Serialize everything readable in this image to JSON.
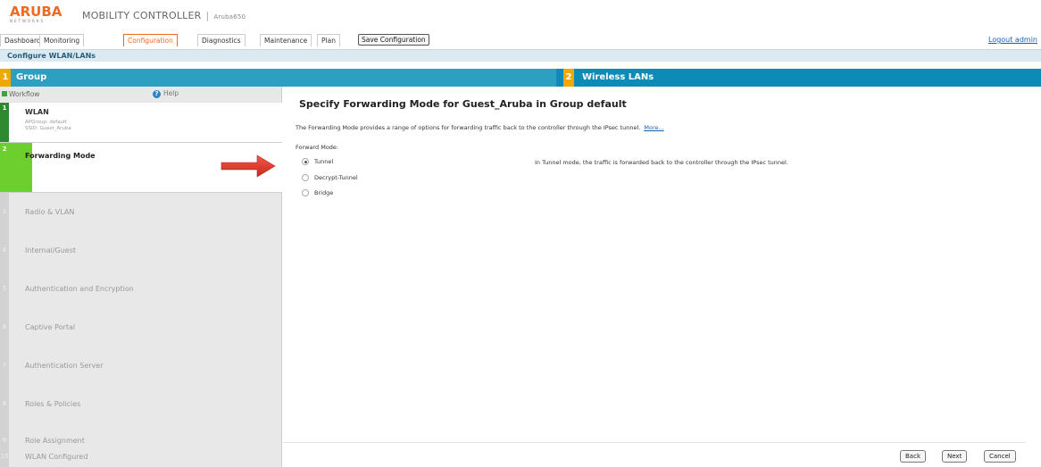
{
  "header": {
    "logo_text": "ARUBA",
    "logo_sub": "NETWORKS",
    "product": "MOBILITY CONTROLLER",
    "separator": "|",
    "host": "Aruba650"
  },
  "nav": {
    "tabs": [
      "Dashboard",
      "Monitoring",
      "Configuration",
      "Diagnostics",
      "Maintenance",
      "Plan"
    ],
    "active_tab": "Configuration",
    "save_label": "Save Configuration",
    "logout": "Logout admin"
  },
  "page_title": "Configure WLAN/LANs",
  "steps": [
    {
      "num": "1",
      "label": "Group"
    },
    {
      "num": "2",
      "label": "Wireless LANs"
    }
  ],
  "sidebar": {
    "workflow": "Workflow",
    "help": "Help",
    "items": [
      {
        "num": "1",
        "label": "WLAN",
        "sub1": "APGroup: default",
        "sub2": "SSID: Guest_Aruba",
        "state": "done"
      },
      {
        "num": "2",
        "label": "Forwarding Mode",
        "state": "current"
      },
      {
        "num": "3",
        "label": "Radio & VLAN",
        "state": "todo"
      },
      {
        "num": "4",
        "label": "Internal/Guest",
        "state": "todo"
      },
      {
        "num": "5",
        "label": "Authentication and Encryption",
        "state": "todo"
      },
      {
        "num": "6",
        "label": "Captive Portal",
        "state": "todo"
      },
      {
        "num": "7",
        "label": "Authentication Server",
        "state": "todo"
      },
      {
        "num": "8",
        "label": "Roles & Policies",
        "state": "todo"
      },
      {
        "num": "9",
        "label": "Role Assignment",
        "state": "todo"
      },
      {
        "num": "10",
        "label": "WLAN Configured",
        "state": "todo"
      }
    ]
  },
  "main": {
    "title": "Specify Forwarding Mode for Guest_Aruba in Group default",
    "description": "The Forwarding Mode provides a range of options for forwarding traffic back to the controller through the IPsec tunnel.",
    "more_link": "More...",
    "forward_mode_label": "Forward Mode:",
    "options": [
      "Tunnel",
      "Decrypt-Tunnel",
      "Bridge"
    ],
    "selected": "Tunnel",
    "mode_description": "In Tunnel mode, the traffic is forwarded back to the controller through the IPsec tunnel."
  },
  "buttons": {
    "back": "Back",
    "next": "Next",
    "cancel": "Cancel"
  },
  "colors": {
    "accent": "#f26a21",
    "step_bar": "#0b8bb5",
    "step_num": "#f0a800",
    "done_green": "#2f8a2f",
    "current_green": "#6ccf2d",
    "arrow_red": "#e03c2f"
  }
}
